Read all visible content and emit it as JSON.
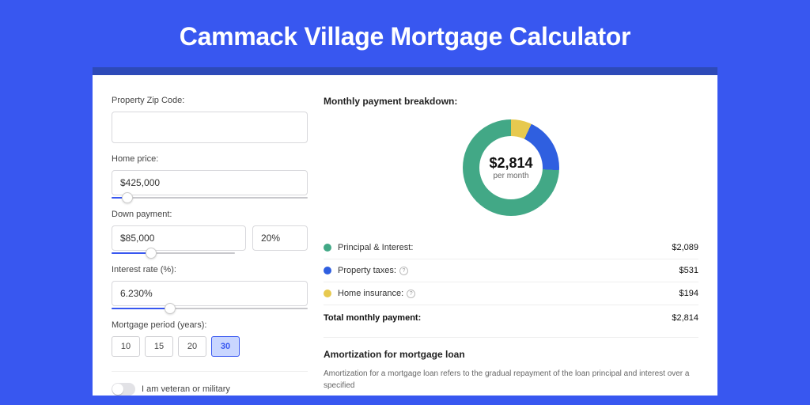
{
  "title": "Cammack Village Mortgage Calculator",
  "form": {
    "zip": {
      "label": "Property Zip Code:",
      "value": ""
    },
    "price": {
      "label": "Home price:",
      "value": "$425,000",
      "slider_pct": 8
    },
    "down": {
      "label": "Down payment:",
      "value": "$85,000",
      "pct": "20%",
      "slider_pct": 20
    },
    "rate": {
      "label": "Interest rate (%):",
      "value": "6.230%",
      "slider_pct": 30
    },
    "period": {
      "label": "Mortgage period (years):",
      "options": [
        "10",
        "15",
        "20",
        "30"
      ],
      "selected": "30"
    },
    "veteran": {
      "label": "I am veteran or military",
      "checked": false
    }
  },
  "breakdown": {
    "title": "Monthly payment breakdown:",
    "center_amount": "$2,814",
    "center_sub": "per month",
    "items": [
      {
        "label": "Principal & Interest:",
        "value": "$2,089",
        "color": "green",
        "info": false
      },
      {
        "label": "Property taxes:",
        "value": "$531",
        "color": "blue",
        "info": true
      },
      {
        "label": "Home insurance:",
        "value": "$194",
        "color": "yellow",
        "info": true
      }
    ],
    "total_label": "Total monthly payment:",
    "total_value": "$2,814"
  },
  "amort": {
    "title": "Amortization for mortgage loan",
    "text": "Amortization for a mortgage loan refers to the gradual repayment of the loan principal and interest over a specified"
  },
  "chart_data": {
    "type": "pie",
    "title": "Monthly payment breakdown",
    "series": [
      {
        "name": "Principal & Interest",
        "value": 2089,
        "color": "#42a886"
      },
      {
        "name": "Property taxes",
        "value": 531,
        "color": "#2f5fe0"
      },
      {
        "name": "Home insurance",
        "value": 194,
        "color": "#e7c94f"
      }
    ],
    "total": 2814
  }
}
